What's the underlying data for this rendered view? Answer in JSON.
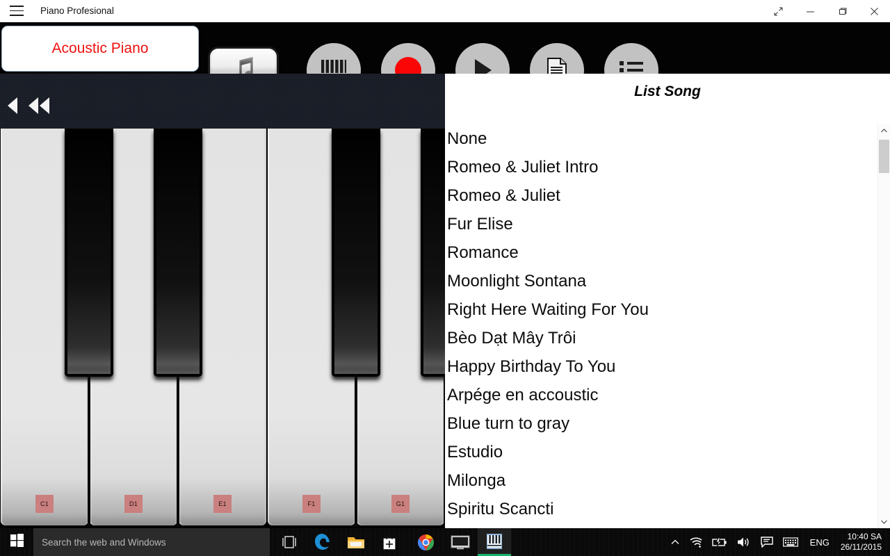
{
  "window": {
    "title": "Piano Profesional",
    "menu_icon": "hamburger-icon",
    "controls": {
      "restore_label": "Restore Down",
      "minimize_label": "Minimize",
      "maximize_label": "Maximize",
      "close_label": "Close"
    }
  },
  "toolbar": {
    "instrument": "Acoustic Piano",
    "instrument_color": "#ee1111",
    "buttons": [
      {
        "name": "note-button",
        "icon": "music-note-icon"
      },
      {
        "name": "keys-button",
        "icon": "piano-keys-icon"
      },
      {
        "name": "record-button",
        "icon": "record-icon",
        "color": "#fa0606"
      },
      {
        "name": "play-button",
        "icon": "play-icon"
      },
      {
        "name": "sheet-button",
        "icon": "sheet-music-icon"
      },
      {
        "name": "list-button",
        "icon": "list-icon"
      }
    ]
  },
  "navstrip": {
    "prev_label": "Previous octave",
    "prev_fast_label": "Scroll left fast"
  },
  "keyboard": {
    "white_labels": [
      "C1",
      "D1",
      "E1",
      "F1",
      "G1"
    ],
    "label_bg": "#c9807e"
  },
  "songs": {
    "header": "List Song",
    "items": [
      "None",
      "Romeo & Juliet Intro",
      "Romeo & Juliet",
      "Fur Elise",
      "Romance",
      "Moonlight Sontana",
      "Right Here Waiting For You",
      "Bèo Dạt Mây Trôi",
      "Happy Birthday To You",
      "Arpége en accoustic",
      "Blue turn to gray",
      "Estudio",
      "Milonga",
      "Spiritu Scancti"
    ],
    "scroll_up_label": "Scroll up",
    "scroll_down_label": "Scroll down"
  },
  "taskbar": {
    "start_label": "Start",
    "search_placeholder": "Search the web and Windows",
    "apps": [
      {
        "name": "taskview-icon"
      },
      {
        "name": "edge-icon"
      },
      {
        "name": "explorer-icon"
      },
      {
        "name": "store-icon"
      },
      {
        "name": "chrome-icon"
      },
      {
        "name": "display-icon"
      },
      {
        "name": "piano-app-icon"
      }
    ],
    "tray": {
      "chevron": "show-hidden-icons",
      "wifi": "wifi-icon",
      "battery": "battery-icon",
      "volume": "volume-icon",
      "action_center": "action-center-icon",
      "keyboard": "touch-keyboard-icon",
      "language": "ENG",
      "time": "10:40 SA",
      "date": "26/11/2015"
    }
  }
}
